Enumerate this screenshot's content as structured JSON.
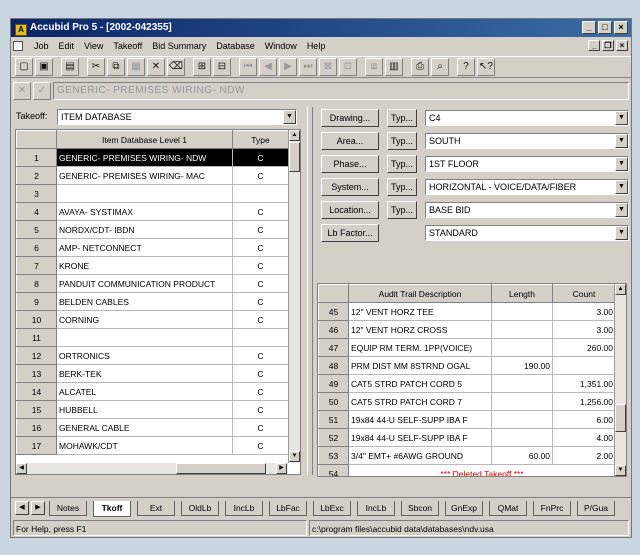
{
  "window": {
    "title": "Accubid Pro 5 - [2002-042355]",
    "app_icon": "A"
  },
  "menu": [
    "Job",
    "Edit",
    "View",
    "Takeoff",
    "Bid Summary",
    "Database",
    "Window",
    "Help"
  ],
  "command": {
    "text": "GENERIC- PREMISES WIRING- NDW"
  },
  "takeoff": {
    "label": "Takeoff:",
    "value": "ITEM DATABASE"
  },
  "item_grid": {
    "columns": [
      "Item Database  Level 1",
      "Type"
    ],
    "rows": [
      {
        "n": "1",
        "desc": "GENERIC- PREMISES WIRING- NDW",
        "type": "C",
        "selected": true
      },
      {
        "n": "2",
        "desc": "GENERIC- PREMISES WIRING- MAC",
        "type": "C"
      },
      {
        "n": "3",
        "desc": "",
        "type": ""
      },
      {
        "n": "4",
        "desc": "AVAYA- SYSTIMAX",
        "type": "C"
      },
      {
        "n": "5",
        "desc": "NORDX/CDT- IBDN",
        "type": "C"
      },
      {
        "n": "6",
        "desc": "AMP- NETCONNECT",
        "type": "C"
      },
      {
        "n": "7",
        "desc": "KRONE",
        "type": "C"
      },
      {
        "n": "8",
        "desc": "PANDUIT COMMUNICATION PRODUCT",
        "type": "C"
      },
      {
        "n": "9",
        "desc": "BELDEN CABLES",
        "type": "C"
      },
      {
        "n": "10",
        "desc": "CORNING",
        "type": "C"
      },
      {
        "n": "11",
        "desc": "",
        "type": ""
      },
      {
        "n": "12",
        "desc": "ORTRONICS",
        "type": "C"
      },
      {
        "n": "13",
        "desc": "BERK-TEK",
        "type": "C"
      },
      {
        "n": "14",
        "desc": "ALCATEL",
        "type": "C"
      },
      {
        "n": "15",
        "desc": "HUBBELL",
        "type": "C"
      },
      {
        "n": "16",
        "desc": "GENERAL CABLE",
        "type": "C"
      },
      {
        "n": "17",
        "desc": "MOHAWK/CDT",
        "type": "C"
      }
    ]
  },
  "fields": [
    {
      "button": "Drawing...",
      "typ": "Typ...",
      "value": "C4"
    },
    {
      "button": "Area...",
      "typ": "Typ...",
      "value": "SOUTH"
    },
    {
      "button": "Phase...",
      "typ": "Typ...",
      "value": "1ST FLOOR"
    },
    {
      "button": "System...",
      "typ": "Typ...",
      "value": "HORIZONTAL - VOICE/DATA/FIBER"
    },
    {
      "button": "Location...",
      "typ": "Typ...",
      "value": "BASE BID"
    },
    {
      "button": "Lb Factor...",
      "typ": "",
      "value": "STANDARD"
    }
  ],
  "audit_grid": {
    "columns": [
      "Audit Trail Description",
      "Length",
      "Count"
    ],
    "rows": [
      {
        "n": "45",
        "desc": "12\" VENT HORZ TEE",
        "length": "",
        "count": "3.00"
      },
      {
        "n": "46",
        "desc": "12\" VENT HORZ CROSS",
        "length": "",
        "count": "3.00"
      },
      {
        "n": "47",
        "desc": "EQUIP RM TERM. 1PP(VOICE)",
        "length": "",
        "count": "260.00"
      },
      {
        "n": "48",
        "desc": "PRM DIST MM 8STRND OGAL",
        "length": "190.00",
        "count": ""
      },
      {
        "n": "49",
        "desc": "CAT5 STRD PATCH CORD  5",
        "length": "",
        "count": "1,351.00"
      },
      {
        "n": "50",
        "desc": "CAT5 STRD PATCH CORD  7",
        "length": "",
        "count": "1,256.00"
      },
      {
        "n": "51",
        "desc": "19x84 44-U SELF-SUPP IBA F",
        "length": "",
        "count": "6.00"
      },
      {
        "n": "52",
        "desc": "19x84 44-U SELF-SUPP IBA F",
        "length": "",
        "count": "4.00"
      },
      {
        "n": "53",
        "desc": "3/4\" EMT+ #6AWG GROUND",
        "length": "60.00",
        "count": "2.00"
      },
      {
        "n": "54",
        "desc": "*** Deleted Takeoff ***",
        "length": "",
        "count": "",
        "deleted": true
      }
    ]
  },
  "tabs": [
    "Notes",
    "Tkoff",
    "Ext",
    "OldLb",
    "IncLb",
    "LbFac",
    "LbExc",
    "IncLb",
    "Sbcon",
    "GnExp",
    "QMat",
    "FnPrc",
    "P/Gua"
  ],
  "active_tab": "Tkoff",
  "status": {
    "left": "For Help, press F1",
    "right": "c:\\program files\\accubid data\\databases\\ndv.usa"
  }
}
